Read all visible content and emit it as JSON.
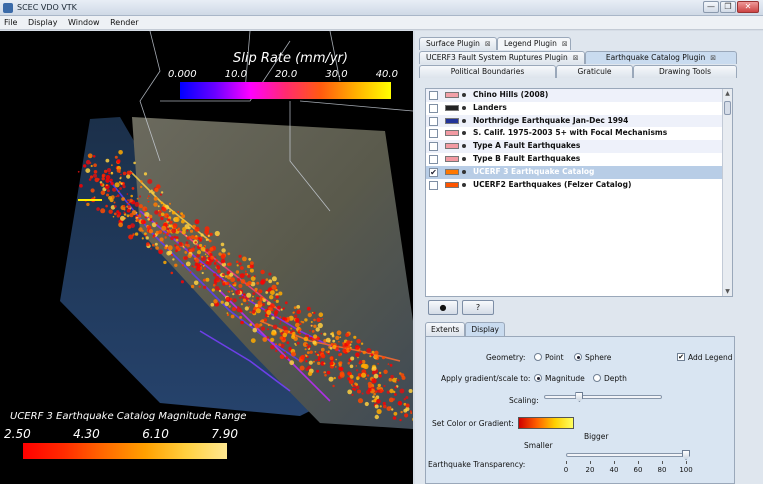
{
  "window": {
    "title": "SCEC VDO VTK",
    "buttons": [
      "—",
      "❐",
      "✕"
    ]
  },
  "menu": [
    "File",
    "Display",
    "Window",
    "Render"
  ],
  "viewport": {
    "slip_legend": {
      "title": "Slip Rate (mm/yr)",
      "ticks": [
        "0.000",
        "10.0",
        "20.0",
        "30.0",
        "40.0"
      ]
    },
    "mag_legend": {
      "title": "UCERF 3 Earthquake Catalog Magnitude Range",
      "ticks": [
        "2.50",
        "4.30",
        "6.10",
        "7.90"
      ]
    }
  },
  "tabs": {
    "row1": [
      {
        "label": "Surface Plugin",
        "close": "⊠"
      },
      {
        "label": "Legend Plugin",
        "close": "⊠"
      }
    ],
    "row2": [
      {
        "label": "UCERF3 Fault System Ruptures Plugin",
        "close": "⊠"
      },
      {
        "label": "Earthquake Catalog Plugin",
        "close": "⊠"
      }
    ],
    "row3": [
      {
        "label": "Political Boundaries"
      },
      {
        "label": "Graticule"
      },
      {
        "label": "Drawing Tools"
      }
    ]
  },
  "catalogs": [
    {
      "label": "Chino Hills (2008)",
      "checked": false,
      "swatch": "#f2a0a8"
    },
    {
      "label": "Landers",
      "checked": false,
      "swatch": "#222222"
    },
    {
      "label": "Northridge Earthquake Jan-Dec 1994",
      "checked": false,
      "swatch": "#223399"
    },
    {
      "label": "S. Calif. 1975-2003 5+ with Focal Mechanisms",
      "checked": false,
      "swatch": "#f29aa2"
    },
    {
      "label": "Type A Fault Earthquakes",
      "checked": false,
      "swatch": "#f29aa2"
    },
    {
      "label": "Type B Fault Earthquakes",
      "checked": false,
      "swatch": "#f29aa2"
    },
    {
      "label": "UCERF 3 Earthquake Catalog",
      "checked": true,
      "swatch": "#ff7700"
    },
    {
      "label": "UCERF2 Earthquakes (Felzer Catalog)",
      "checked": false,
      "swatch": "#ff5500"
    }
  ],
  "buttons": {
    "globe": "●",
    "help": "?"
  },
  "subtabs": [
    "Extents",
    "Display"
  ],
  "display": {
    "geometry_label": "Geometry:",
    "geometry_options": [
      "Point",
      "Sphere"
    ],
    "geometry_selected": "Sphere",
    "add_legend_label": "Add Legend",
    "add_legend_checked": true,
    "gradient_label": "Apply gradient/scale to:",
    "gradient_options": [
      "Magnitude",
      "Depth"
    ],
    "gradient_selected": "Magnitude",
    "scaling_label": "Scaling:",
    "scaling_value": 0.3,
    "color_label": "Set Color or Gradient:",
    "smaller_label": "Smaller",
    "bigger_label": "Bigger",
    "transparency_label": "Earthquake Transparency:",
    "transparency_ticks": [
      "0",
      "20",
      "40",
      "60",
      "80",
      "100"
    ],
    "transparency_value": 100
  }
}
